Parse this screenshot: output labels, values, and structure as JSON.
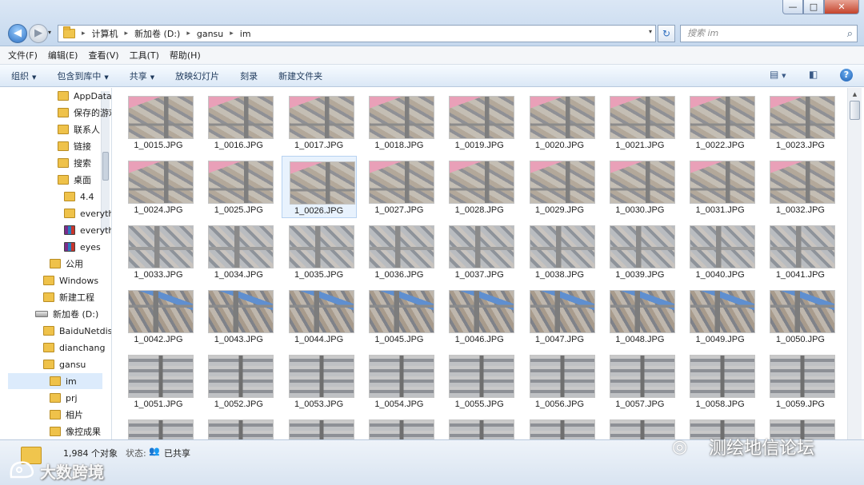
{
  "window": {
    "controls": {
      "minimize": "—",
      "maximize": "□",
      "close": "✕"
    }
  },
  "nav": {
    "back": "◀",
    "forward": "▶",
    "dropdown": "▾"
  },
  "address": {
    "crumbs": [
      "计算机",
      "新加卷 (D:)",
      "gansu",
      "im"
    ],
    "separator": "▸",
    "refresh": "↻"
  },
  "search": {
    "placeholder": "搜索 im",
    "icon": "⌕"
  },
  "menubar": [
    "文件(F)",
    "编辑(E)",
    "查看(V)",
    "工具(T)",
    "帮助(H)"
  ],
  "commandbar": {
    "items": [
      "组织",
      "包含到库中",
      "共享",
      "放映幻灯片",
      "刻录",
      "新建文件夹"
    ],
    "dropdown_arrow": "▼",
    "help": "?"
  },
  "sidebar": {
    "items": [
      {
        "label": "AppData",
        "icon": "folder"
      },
      {
        "label": "保存的游戏",
        "icon": "folder"
      },
      {
        "label": "联系人",
        "icon": "folder"
      },
      {
        "label": "链接",
        "icon": "folder"
      },
      {
        "label": "搜索",
        "icon": "folder"
      },
      {
        "label": "桌面",
        "icon": "folder"
      },
      {
        "label": "4.4",
        "icon": "folder"
      },
      {
        "label": "everything",
        "icon": "folder"
      },
      {
        "label": "everything",
        "icon": "rar"
      },
      {
        "label": "eyes",
        "icon": "rar"
      },
      {
        "label": "公用",
        "icon": "folder"
      },
      {
        "label": "Windows",
        "icon": "folder"
      },
      {
        "label": "新建工程",
        "icon": "folder"
      },
      {
        "label": "新加卷 (D:)",
        "icon": "drive"
      },
      {
        "label": "BaiduNetdisk",
        "icon": "folder"
      },
      {
        "label": "dianchang",
        "icon": "folder"
      },
      {
        "label": "gansu",
        "icon": "folder"
      },
      {
        "label": "im",
        "icon": "folder"
      },
      {
        "label": "prj",
        "icon": "folder"
      },
      {
        "label": "相片",
        "icon": "folder"
      },
      {
        "label": "像控成果",
        "icon": "folder"
      }
    ],
    "selected": "im"
  },
  "files": [
    "1_0015.JPG",
    "1_0016.JPG",
    "1_0017.JPG",
    "1_0018.JPG",
    "1_0019.JPG",
    "1_0020.JPG",
    "1_0021.JPG",
    "1_0022.JPG",
    "1_0023.JPG",
    "1_0024.JPG",
    "1_0025.JPG",
    "1_0026.JPG",
    "1_0027.JPG",
    "1_0028.JPG",
    "1_0029.JPG",
    "1_0030.JPG",
    "1_0031.JPG",
    "1_0032.JPG",
    "1_0033.JPG",
    "1_0034.JPG",
    "1_0035.JPG",
    "1_0036.JPG",
    "1_0037.JPG",
    "1_0038.JPG",
    "1_0039.JPG",
    "1_0040.JPG",
    "1_0041.JPG",
    "1_0042.JPG",
    "1_0043.JPG",
    "1_0044.JPG",
    "1_0045.JPG",
    "1_0046.JPG",
    "1_0047.JPG",
    "1_0048.JPG",
    "1_0049.JPG",
    "1_0050.JPG",
    "1_0051.JPG",
    "1_0052.JPG",
    "1_0053.JPG",
    "1_0054.JPG",
    "1_0055.JPG",
    "1_0056.JPG",
    "1_0057.JPG",
    "1_0058.JPG",
    "1_0059.JPG",
    "",
    "",
    "",
    "",
    "",
    "",
    "",
    "",
    ""
  ],
  "selected_file": "1_0026.JPG",
  "status": {
    "count": "1,984 个对象",
    "state_label": "状态:",
    "share_icon": "👥",
    "state_value": "已共享"
  },
  "watermarks": {
    "left": "大数跨境",
    "right": "测绘地信论坛",
    "right_icon": "◎"
  }
}
